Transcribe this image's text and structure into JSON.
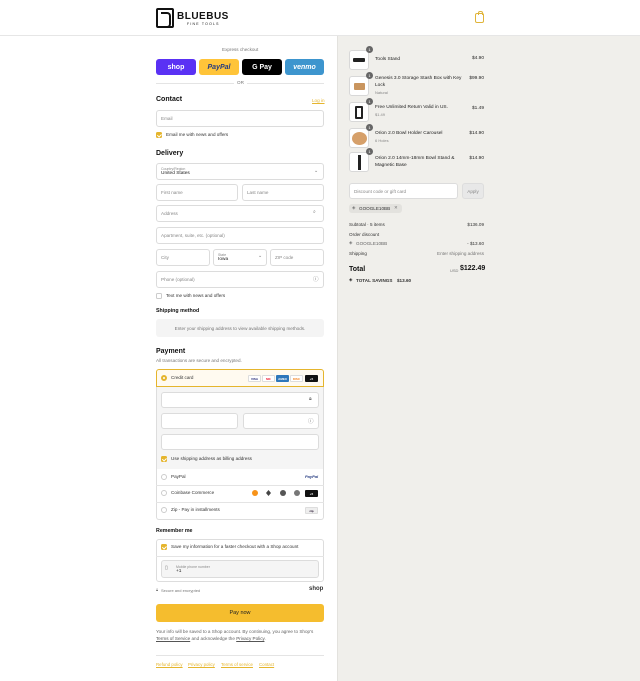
{
  "brand": {
    "name": "BLUEBUS",
    "tagline": "FINE TOOLS"
  },
  "express": {
    "title": "Express checkout",
    "or": "OR",
    "buttons": [
      {
        "label": "shop",
        "bg": "#5a31f4",
        "fg": "#ffffff"
      },
      {
        "label": "PayPal",
        "bg": "#ffc439",
        "fg": "#253b80"
      },
      {
        "label": "G Pay",
        "bg": "#000000",
        "fg": "#ffffff"
      },
      {
        "label": "venmo",
        "bg": "#3d95ce",
        "fg": "#ffffff"
      }
    ]
  },
  "contact": {
    "title": "Contact",
    "login": "Log in",
    "email_placeholder": "Email",
    "news_label": "Email me with news and offers"
  },
  "delivery": {
    "title": "Delivery",
    "country_label": "Country/Region",
    "country_value": "United States",
    "first_name": "First name",
    "last_name": "Last name",
    "address": "Address",
    "apartment": "Apartment, suite, etc. (optional)",
    "city": "City",
    "state_label": "State",
    "state_value": "Iowa",
    "zip": "ZIP code",
    "phone": "Phone (optional)",
    "text_label": "Text me with news and offers"
  },
  "shipping": {
    "title": "Shipping method",
    "message": "Enter your shipping address to view available shipping methods."
  },
  "payment": {
    "title": "Payment",
    "subtitle": "All transactions are secure and encrypted.",
    "credit_card": "Credit card",
    "card_brands": [
      "VISA",
      "MC",
      "AMEX",
      "DISC",
      "+5"
    ],
    "billing_label": "Use shipping address as billing address",
    "paypal": "PayPal",
    "paypal_logo": "PayPal",
    "coinbase": "Coinbase Commerce",
    "zip": "Zip - Pay in installments",
    "zip_logo": "zip"
  },
  "remember": {
    "title": "Remember me",
    "save_label": "Save my information for a faster checkout with a Shop account",
    "mobile_label": "Mobile phone number",
    "mobile_value": "+1",
    "secure": "Secure and encrypted",
    "shop": "shop"
  },
  "pay_button": "Pay now",
  "legal": {
    "text1": "Your info will be saved to a Shop account. By continuing, you agree to Shop's",
    "terms": "Terms of Service",
    "text2": "and acknowledge the",
    "privacy": "Privacy Policy",
    "period": "."
  },
  "footer_links": [
    "Refund policy",
    "Privacy policy",
    "Terms of service",
    "Contact"
  ],
  "summary": {
    "items": [
      {
        "name": "Tools Stand",
        "sub": "",
        "price": "$4.90",
        "qty": "1"
      },
      {
        "name": "Genesis 3.0 Storage Stash Box with Key Lock",
        "sub": "Natural",
        "price": "$99.90",
        "qty": "1"
      },
      {
        "name": "Free Unlimited Return Valid in US.",
        "sub": "$1.49",
        "price": "$1.49",
        "qty": "1"
      },
      {
        "name": "Orion 2.0 Bowl Holder Carousel",
        "sub": "6 Holes",
        "price": "$14.90",
        "qty": "1"
      },
      {
        "name": "Orion 2.0 14mm-18mm Bowl Stand & Magnetic Base",
        "sub": "",
        "price": "$14.90",
        "qty": "1"
      }
    ],
    "discount_placeholder": "Discount code or gift card",
    "apply": "Apply",
    "code_tag": "GOOGLE10BB",
    "subtotal_label": "Subtotal · 5 items",
    "subtotal_value": "$136.09",
    "order_discount_label": "Order discount",
    "discount_code": "GOOGLE10BB",
    "discount_value": "- $13.60",
    "shipping_label": "Shipping",
    "shipping_value": "Enter shipping address",
    "total_label": "Total",
    "currency": "USD",
    "total_value": "$122.49",
    "savings_label": "TOTAL SAVINGS",
    "savings_value": "$13.60"
  }
}
